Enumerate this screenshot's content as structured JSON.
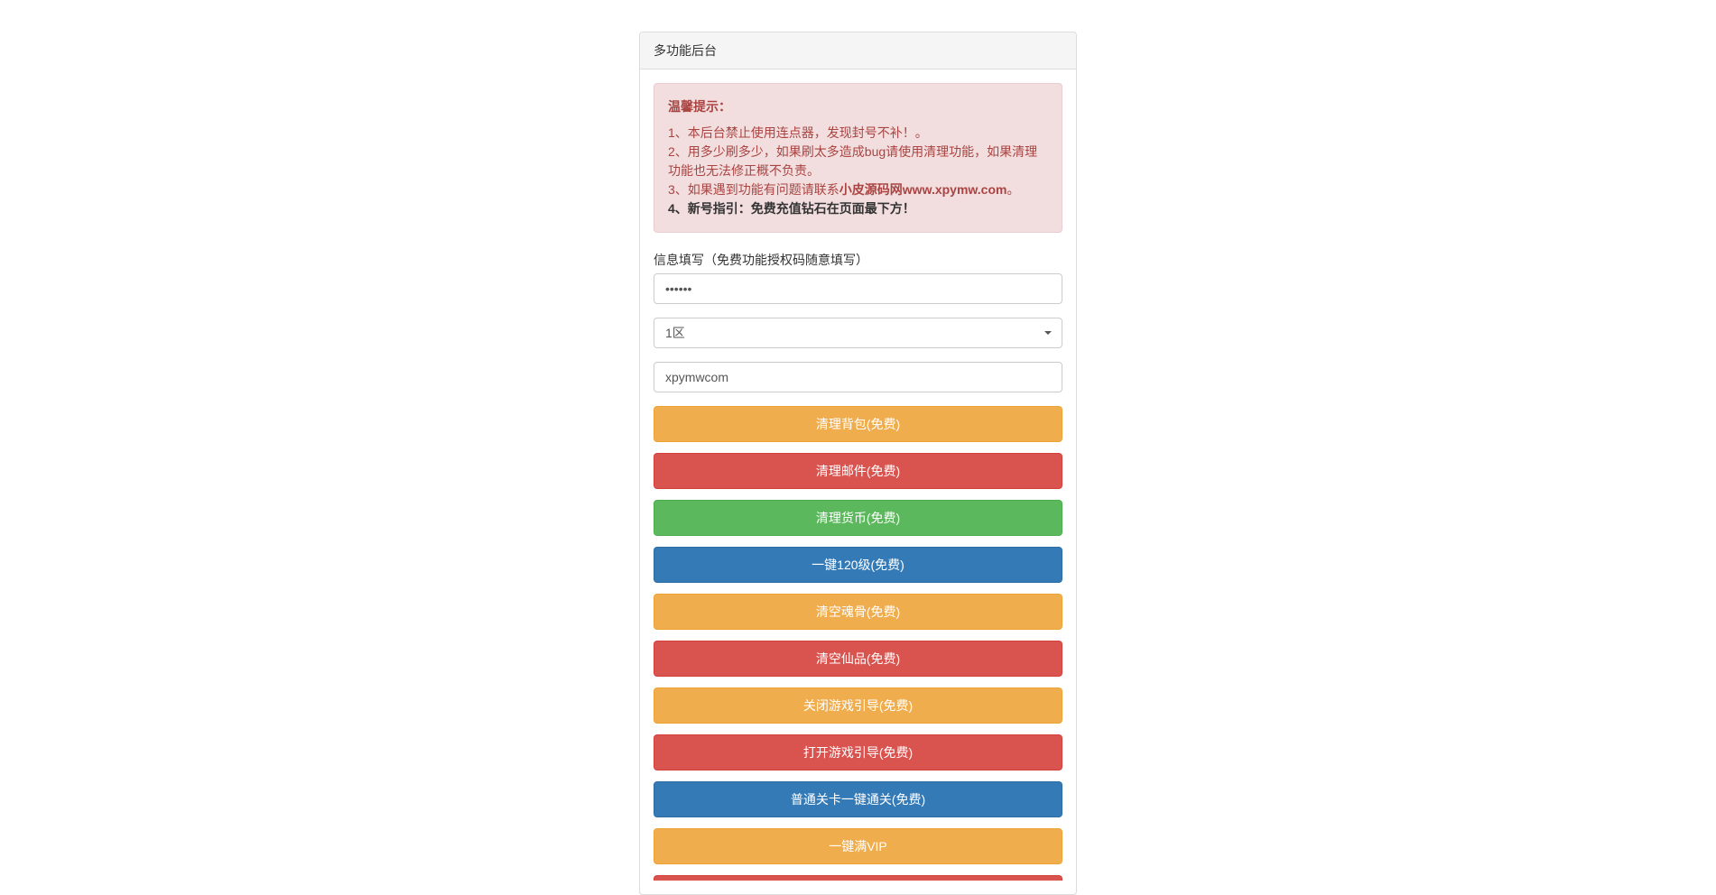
{
  "panel": {
    "title": "多功能后台"
  },
  "alert": {
    "title": "温馨提示：",
    "line1": "1、本后台禁止使用连点器，发现封号不补！。",
    "line2": "2、用多少刷多少，如果刷太多造成bug请使用清理功能，如果清理功能也无法修正概不负责。",
    "line3_prefix": "3、如果遇到功能有问题请联系",
    "line3_link": "小皮源码网www.xpymw.com",
    "line3_suffix": "。",
    "line4": "4、新号指引：免费充值钻石在页面最下方！"
  },
  "form": {
    "label": "信息填写（免费功能授权码随意填写）",
    "password_value": "••••••",
    "zone_value": "1区",
    "text_value": "xpymwcom"
  },
  "buttons": {
    "b1": "清理背包(免费)",
    "b2": "清理邮件(免费)",
    "b3": "清理货币(免费)",
    "b4": "一键120级(免费)",
    "b5": "清空魂骨(免费)",
    "b6": "清空仙品(免费)",
    "b7": "关闭游戏引导(免费)",
    "b8": "打开游戏引导(免费)",
    "b9": "普通关卡一键通关(免费)",
    "b10": "一键满VIP"
  }
}
